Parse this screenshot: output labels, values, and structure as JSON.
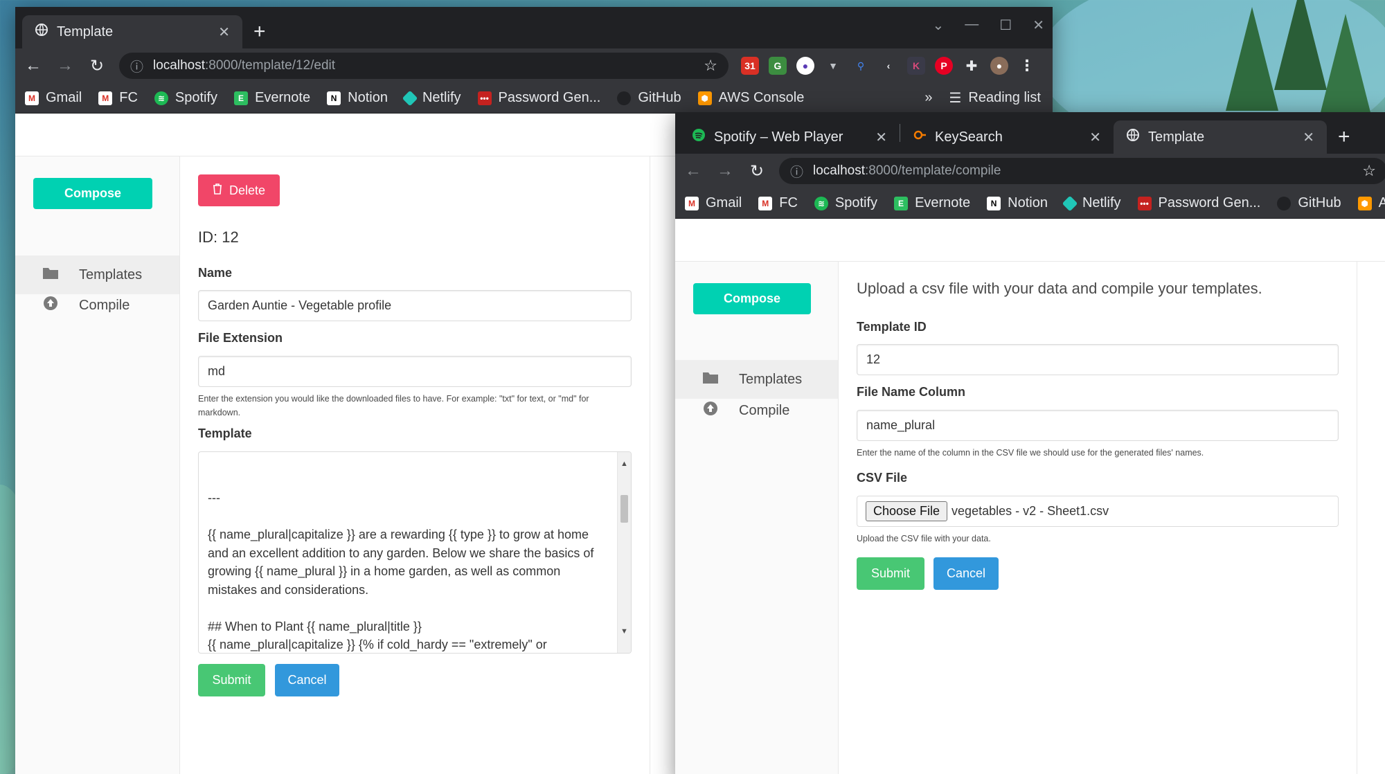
{
  "back_window": {
    "tabs": [
      {
        "title": "Template",
        "active": true
      }
    ],
    "url_host": "localhost",
    "url_path": ":8000/template/12/edit",
    "bookmarks": [
      "Gmail",
      "FC",
      "Spotify",
      "Evernote",
      "Notion",
      "Netlify",
      "Password Gen...",
      "GitHub",
      "AWS Console"
    ],
    "more_bookmarks": "»",
    "reading_list": "Reading list",
    "sidebar": {
      "compose": "Compose",
      "items": [
        {
          "label": "Templates",
          "active": true
        },
        {
          "label": "Compile",
          "active": false
        }
      ]
    },
    "form": {
      "delete_label": "Delete",
      "id_text": "ID: 12",
      "name_label": "Name",
      "name_value": "Garden Auntie - Vegetable profile",
      "ext_label": "File Extension",
      "ext_value": "md",
      "ext_help": "Enter the extension you would like the downloaded files to have. For example: \"txt\" for text, or \"md\" for markdown.",
      "template_label": "Template",
      "template_value": "---\n\n{{ name_plural|capitalize }} are a rewarding {{ type }} to grow at home and an excellent addition to any garden. Below we share the basics of growing {{ name_plural }} in a home garden, as well as common mistakes and considerations.\n\n## When to Plant {{ name_plural|title }}\n{{ name_plural|capitalize }} {% if cold_hardy == \"extremely\" or cold_hardy == \"somewhat\" %}are{% else %}are not{% endif %} a frost tolerant {{type}}. This means the best time to plant them is {% if",
      "submit": "Submit",
      "cancel": "Cancel"
    }
  },
  "front_window": {
    "tabs": [
      {
        "title": "Spotify – Web Player",
        "active": false
      },
      {
        "title": "KeySearch",
        "active": false
      },
      {
        "title": "Template",
        "active": true
      }
    ],
    "url_host": "localhost",
    "url_path": ":8000/template/compile",
    "bookmarks": [
      "Gmail",
      "FC",
      "Spotify",
      "Evernote",
      "Notion",
      "Netlify",
      "Password Gen...",
      "GitHub",
      "A"
    ],
    "sidebar": {
      "compose": "Compose",
      "items": [
        {
          "label": "Templates",
          "active": true
        },
        {
          "label": "Compile",
          "active": false
        }
      ]
    },
    "form": {
      "heading": "Upload a csv file with your data and compile your templates.",
      "template_id_label": "Template ID",
      "template_id_value": "12",
      "file_name_col_label": "File Name Column",
      "file_name_col_value": "name_plural",
      "file_name_col_help": "Enter the name of the column in the CSV file we should use for the generated files' names.",
      "csv_label": "CSV File",
      "choose_file": "Choose File",
      "csv_filename": "vegetables - v2 - Sheet1.csv",
      "csv_help": "Upload the CSV file with your data.",
      "submit": "Submit",
      "cancel": "Cancel"
    }
  },
  "colors": {
    "compose": "#00d1b2",
    "submit": "#48c774",
    "cancel": "#3298dc",
    "delete": "#f14668",
    "chrome_dark": "#202124",
    "chrome_tab": "#35363a"
  }
}
